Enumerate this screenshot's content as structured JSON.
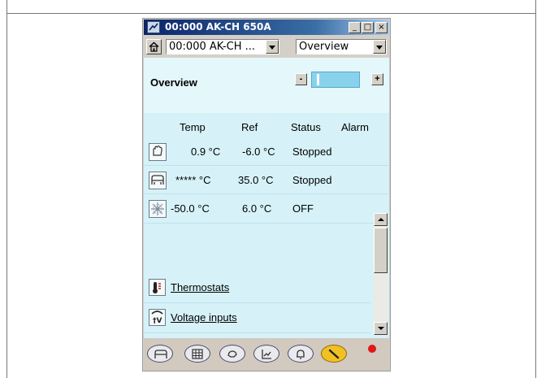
{
  "window": {
    "title": "00:000 AK-CH 650A",
    "minimize_symbol": "_",
    "maximize_symbol": "□",
    "close_symbol": "×"
  },
  "toolbar": {
    "device_select_value": "00:000 AK-CH ...",
    "view_select_value": "Overview",
    "home_icon": "home-icon"
  },
  "pane": {
    "title": "Overview",
    "slider_minus": "-",
    "slider_plus": "+"
  },
  "table": {
    "headers": [
      "Temp",
      "Ref",
      "Status",
      "Alarm"
    ],
    "rows": [
      {
        "icon": "hand-icon",
        "temp": "0.9 °C",
        "ref": "-6.0 °C",
        "status": "Stopped",
        "alarm": ""
      },
      {
        "icon": "display-case-icon",
        "temp": "***** °C",
        "ref": "35.0 °C",
        "status": "Stopped",
        "alarm": ""
      },
      {
        "icon": "defrost-icon",
        "temp": "-50.0 °C",
        "ref": "6.0 °C",
        "status": "OFF",
        "alarm": ""
      }
    ]
  },
  "links": [
    {
      "label": "Thermostats",
      "icon": "thermostat-icon"
    },
    {
      "label": "Voltage inputs",
      "icon": "voltage-input-icon"
    }
  ],
  "bottom_nav": {
    "items": [
      "display-case-icon",
      "grid-icon",
      "hand-icon",
      "chart-icon",
      "bell-icon",
      "wrench-icon"
    ],
    "active_index": 5,
    "alarm_indicator_color": "#e01818"
  },
  "colors": {
    "title_bar": "#0a246a",
    "content_background": "#d6f2f8",
    "active_nav": "#f2c022"
  }
}
